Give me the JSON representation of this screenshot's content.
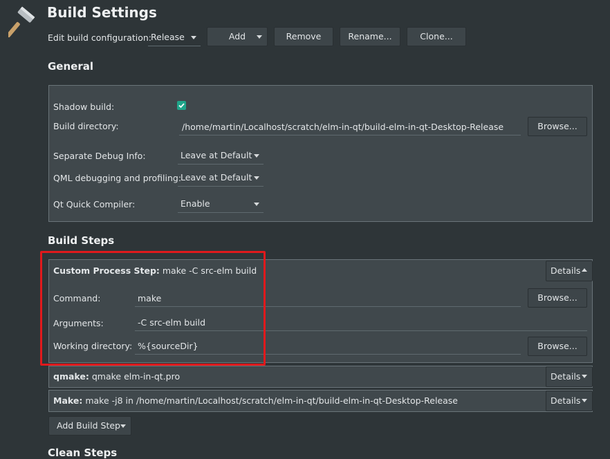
{
  "header": {
    "title": "Build Settings"
  },
  "config_bar": {
    "label": "Edit build configuration:",
    "selected": "Release",
    "add": "Add",
    "remove": "Remove",
    "rename": "Rename...",
    "clone": "Clone..."
  },
  "general": {
    "title": "General",
    "shadow_build_label": "Shadow build:",
    "shadow_build_checked": true,
    "build_dir_label": "Build directory:",
    "build_dir_value": "/home/martin/Localhost/scratch/elm-in-qt/build-elm-in-qt-Desktop-Release",
    "browse": "Browse...",
    "separate_debug_label": "Separate Debug Info:",
    "separate_debug_value": "Leave at Default",
    "qml_debug_label": "QML debugging and profiling:",
    "qml_debug_value": "Leave at Default",
    "qt_quick_label": "Qt Quick Compiler:",
    "qt_quick_value": "Enable"
  },
  "build_steps": {
    "title": "Build Steps",
    "custom": {
      "name": "Custom Process Step:",
      "summary": "make -C src-elm build",
      "details": "Details",
      "command_label": "Command:",
      "command_value": "make",
      "arguments_label": "Arguments:",
      "arguments_value": "-C src-elm build",
      "workdir_label": "Working directory:",
      "workdir_value": "%{sourceDir}",
      "browse": "Browse..."
    },
    "qmake": {
      "name": "qmake:",
      "summary": "qmake elm-in-qt.pro",
      "details": "Details"
    },
    "make": {
      "name": "Make:",
      "summary": "make -j8 in /home/martin/Localhost/scratch/elm-in-qt/build-elm-in-qt-Desktop-Release",
      "details": "Details"
    },
    "add_step": "Add Build Step"
  },
  "clean_steps": {
    "title": "Clean Steps"
  },
  "colors": {
    "background": "#2e3538",
    "panel": "#40484c",
    "accent_check": "#1fa58a",
    "highlight": "#e0191c"
  }
}
